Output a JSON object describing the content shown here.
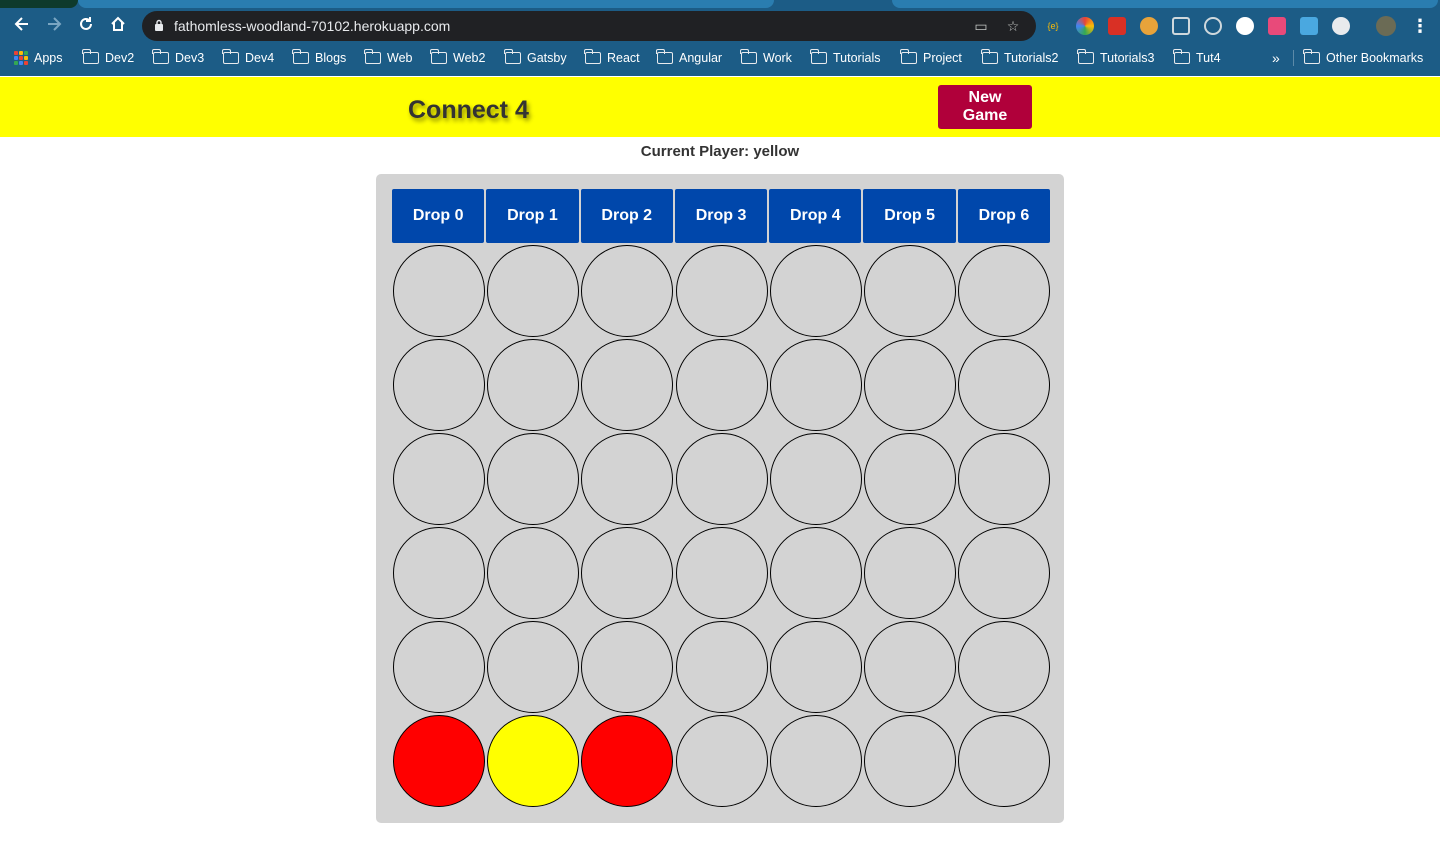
{
  "browser": {
    "url": "fathomless-woodland-70102.herokuapp.com",
    "bookmarks": [
      "Apps",
      "Dev2",
      "Dev3",
      "Dev4",
      "Blogs",
      "Web",
      "Web2",
      "Gatsby",
      "React",
      "Angular",
      "Work",
      "Tutorials",
      "Project",
      "Tutorials2",
      "Tutorials3",
      "Tut4"
    ],
    "overflow_label": "»",
    "other_bookmarks": "Other Bookmarks"
  },
  "app": {
    "title": "Connect 4",
    "new_game_label": "New Game",
    "status_prefix": "Current Player:",
    "current_player": "yellow",
    "status_text": "Current Player: yellow"
  },
  "board": {
    "drop_labels": [
      "Drop 0",
      "Drop 1",
      "Drop 2",
      "Drop 3",
      "Drop 4",
      "Drop 5",
      "Drop 6"
    ],
    "rows": [
      [
        "empty",
        "empty",
        "empty",
        "empty",
        "empty",
        "empty",
        "empty"
      ],
      [
        "empty",
        "empty",
        "empty",
        "empty",
        "empty",
        "empty",
        "empty"
      ],
      [
        "empty",
        "empty",
        "empty",
        "empty",
        "empty",
        "empty",
        "empty"
      ],
      [
        "empty",
        "empty",
        "empty",
        "empty",
        "empty",
        "empty",
        "empty"
      ],
      [
        "empty",
        "empty",
        "empty",
        "empty",
        "empty",
        "empty",
        "empty"
      ],
      [
        "red",
        "yellow",
        "red",
        "empty",
        "empty",
        "empty",
        "empty"
      ]
    ]
  },
  "colors": {
    "header_bg": "#ffff00",
    "new_game_bg": "#b0003a",
    "drop_btn_bg": "#0047ab",
    "board_bg": "#d3d3d3",
    "red_disc": "#ff0000",
    "yellow_disc": "#ffff00"
  }
}
